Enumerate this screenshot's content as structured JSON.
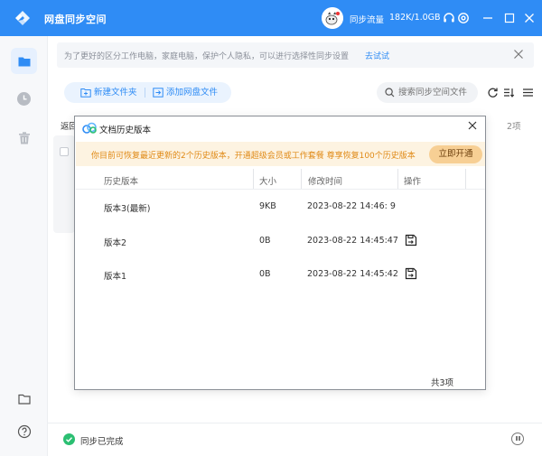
{
  "app": {
    "title": "网盘同步空间",
    "sync_flow_label": "同步流量",
    "sync_flow_value": "182K/1.0GB"
  },
  "colors": {
    "brand": "#2f8cf5",
    "promo_text": "#e08a16",
    "promo_button": "#f7cf94",
    "success": "#2bbf72"
  },
  "notice": {
    "text": "为了更好的区分工作电脑，家庭电脑，保护个人隐私，可以进行选择性同步设置",
    "link": "去试试"
  },
  "toolbar": {
    "new_folder": "新建文件夹",
    "add_cloud_file": "添加网盘文件",
    "search_placeholder": "搜索同步空间文件"
  },
  "list": {
    "back_label": "返回",
    "count_label": "2项"
  },
  "status": {
    "text": "同步已完成"
  },
  "dialog": {
    "title": "文档历史版本",
    "promo_text": "你目前可恢复最近更新的2个历史版本，开通超级会员或工作套餐 尊享恢复100个历史版本",
    "promo_button": "立即开通",
    "columns": [
      "历史版本",
      "大小",
      "修改时间",
      "操作"
    ],
    "rows": [
      {
        "version": "版本3(最新)",
        "size": "9KB",
        "modified": "2023-08-22 14:46: 9",
        "restorable": false
      },
      {
        "version": "版本2",
        "size": "0B",
        "modified": "2023-08-22 14:45:47",
        "restorable": true
      },
      {
        "version": "版本1",
        "size": "0B",
        "modified": "2023-08-22 14:45:42",
        "restorable": true
      }
    ],
    "footer": "共3项"
  }
}
